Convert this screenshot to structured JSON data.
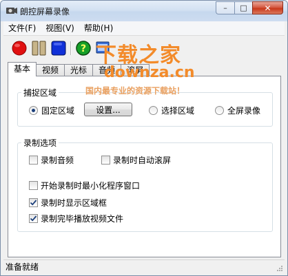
{
  "window": {
    "title": "朗控屏幕录像",
    "controls": {
      "minimize": "–",
      "maximize": "□",
      "close": "✕"
    }
  },
  "menu": {
    "items": [
      "文件(F)",
      "视图(V)",
      "帮助(H)"
    ]
  },
  "toolbar": {
    "icons": [
      "record-icon",
      "pause-icon",
      "stop-icon",
      "help-icon",
      "about-icon"
    ],
    "colors": {
      "record": "#e01010",
      "pause": "#c8b58a",
      "stop": "#1030d8",
      "help": "#16a028"
    }
  },
  "tabs": [
    "基本",
    "视频",
    "光标",
    "音频",
    "滚屏"
  ],
  "capture_area": {
    "title": "捕捉区域",
    "fixed_label": "固定区域",
    "settings_button": "设置...",
    "select_label": "选择区域",
    "fullscreen_label": "全屏录像",
    "selected": "fixed"
  },
  "record_options": {
    "title": "录制选项",
    "items": [
      {
        "label": "录制音频",
        "checked": false
      },
      {
        "label": "录制时自动滚屏",
        "checked": false
      },
      {
        "label": "开始录制时最小化程序窗口",
        "checked": false
      },
      {
        "label": "录制时显示区域框",
        "checked": true
      },
      {
        "label": "录制完毕播放视频文件",
        "checked": true
      }
    ]
  },
  "watermark": {
    "title": "下载之家",
    "url": "downza.cn",
    "tagline": "国内最专业的资源下载站！"
  },
  "status": {
    "text": "准备就绪"
  }
}
